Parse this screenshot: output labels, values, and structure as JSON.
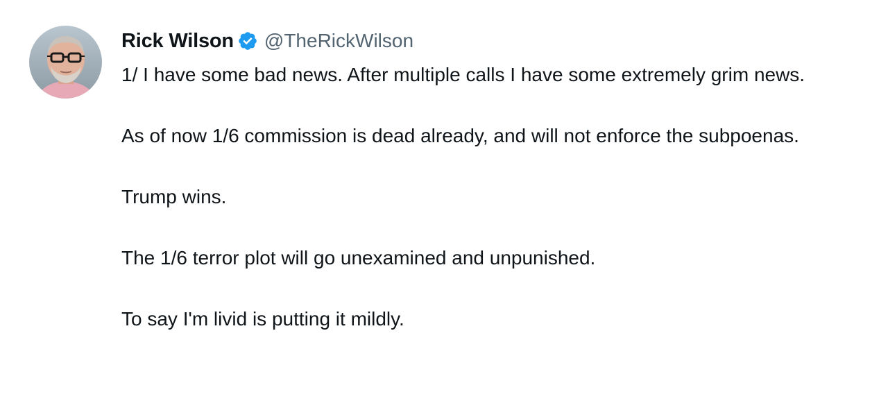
{
  "tweet": {
    "author": {
      "display_name": "Rick Wilson",
      "handle": "@TheRickWilson",
      "verified": true,
      "verified_icon": "verified-badge-icon",
      "avatar": "profile-photo"
    },
    "paragraphs": [
      "1/ I have some bad news. After multiple calls I have some extremely grim news.",
      "As of now 1/6 commission is dead already, and will not enforce the subpoenas.",
      "Trump wins.",
      "The 1/6 terror plot will go unexamined and unpunished.",
      "To say I'm livid is putting it mildly."
    ]
  },
  "colors": {
    "text_primary": "#0f1419",
    "text_secondary": "#536471",
    "verified_blue": "#1d9bf0",
    "background": "#ffffff"
  }
}
